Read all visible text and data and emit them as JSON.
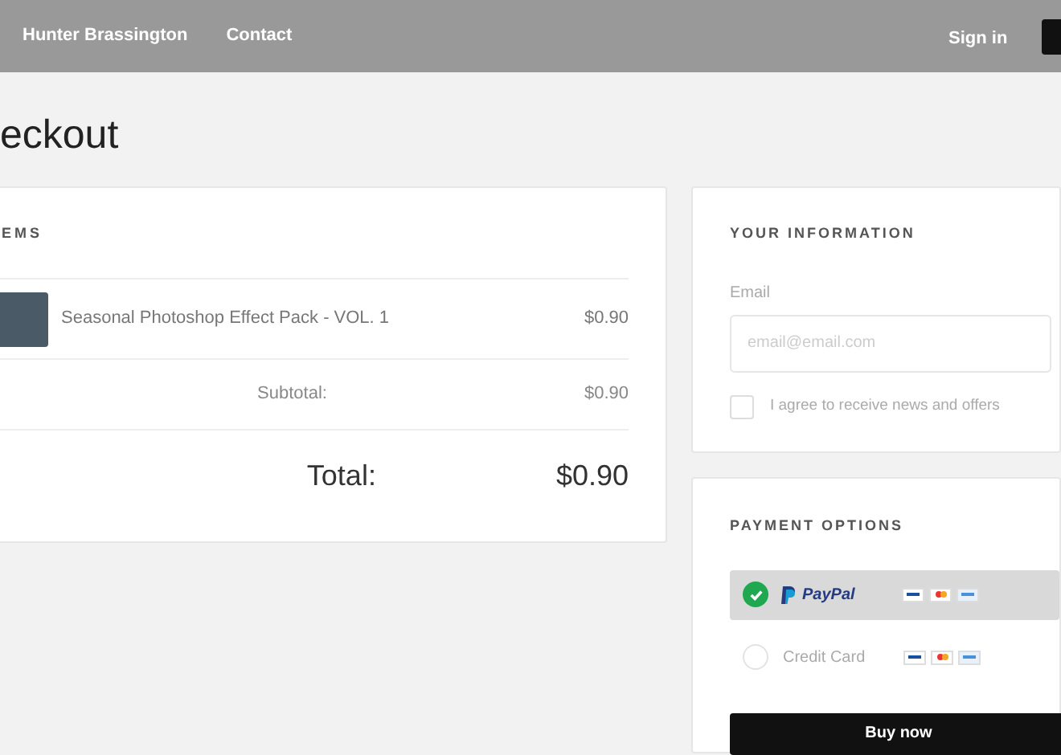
{
  "nav": {
    "links": [
      "Hunter Brassington",
      "Contact"
    ],
    "sign_in": "Sign in"
  },
  "page_title": "eckout",
  "items_card": {
    "heading": "EMS",
    "items": [
      {
        "name": "Seasonal Photoshop Effect Pack - VOL. 1",
        "price": "$0.90"
      }
    ],
    "subtotal_label": "Subtotal:",
    "subtotal": "$0.90",
    "total_label": "Total:",
    "total": "$0.90"
  },
  "info_card": {
    "heading": "YOUR INFORMATION",
    "email_label": "Email",
    "email_placeholder": "email@email.com",
    "agree": {
      "label": "I agree to receive news and offers",
      "checked": false
    }
  },
  "payment_card": {
    "heading": "PAYMENT OPTIONS",
    "options": [
      {
        "kind": "paypal",
        "label": "PayPal",
        "selected": true
      },
      {
        "kind": "card",
        "label": "Credit Card",
        "selected": false
      }
    ],
    "buy_button": "Buy now"
  }
}
